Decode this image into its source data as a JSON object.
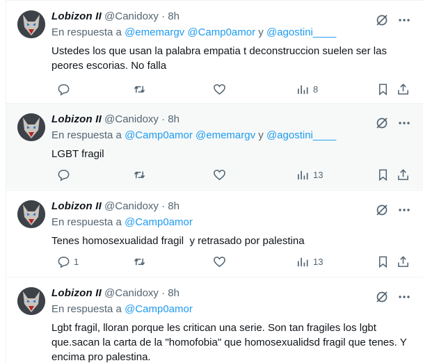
{
  "labels": {
    "reply_prefix": "En respuesta a",
    "and": "y"
  },
  "tweets": [
    {
      "name": "Lobizon II",
      "handle": "@Canidoxy",
      "time": "8h",
      "mentions": [
        "@ememargv",
        "@Camp0amor",
        "@agostini____"
      ],
      "text": "Ustedes los que usan la palabra empatia t deconstruccion suelen ser las peores escorias. No falla",
      "replies": "",
      "views": "8"
    },
    {
      "name": "Lobizon II",
      "handle": "@Canidoxy",
      "time": "8h",
      "mentions": [
        "@Camp0amor",
        "@ememargv",
        "@agostini____"
      ],
      "text": "LGBT fragil",
      "replies": "",
      "views": "13"
    },
    {
      "name": "Lobizon II",
      "handle": "@Canidoxy",
      "time": "8h",
      "mentions": [
        "@Camp0amor"
      ],
      "text": "Tenes homosexualidad fragil  y retrasado por palestina",
      "replies": "1",
      "views": "13"
    },
    {
      "name": "Lobizon II",
      "handle": "@Canidoxy",
      "time": "8h",
      "mentions": [
        "@Camp0amor"
      ],
      "text": "Lgbt fragil, lloran porque les critican una serie. Son tan fragiles los lgbt que.sacan la carta de la \"homofobia\" que homosexualidsd fragil que tenes. Y encima pro palestina.",
      "replies": "",
      "views": ""
    }
  ],
  "icons": [
    "grok-icon",
    "more-icon",
    "reply-icon",
    "retweet-icon",
    "like-icon",
    "views-icon",
    "bookmark-icon",
    "share-icon"
  ],
  "colors": {
    "mention": "#1d9bf0",
    "muted": "#536471",
    "text": "#0f1419",
    "highlight_bg": "#f7f9f9"
  }
}
